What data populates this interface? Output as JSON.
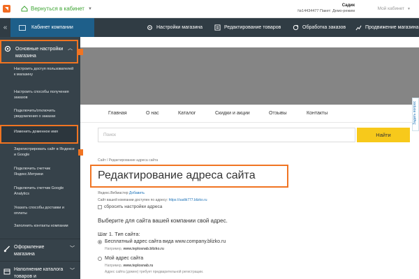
{
  "topbar": {
    "back_label": "Вернуться в кабинет",
    "user_name": "Садик",
    "user_meta": "№14434477 Пакет: Демо-режим",
    "cabinet_label": "Мой кабинет"
  },
  "navbar": {
    "company_label": "Кабинет компании",
    "items": [
      {
        "label": "Настройки магазина",
        "icon": "gear-icon"
      },
      {
        "label": "Редактирование товаров",
        "icon": "list-icon"
      },
      {
        "label": "Обработка заказов",
        "icon": "refresh-icon"
      },
      {
        "label": "Продвижение магазина",
        "icon": "chart-icon"
      }
    ]
  },
  "sidebar": {
    "main_label": "Основные настройки магазина",
    "subitems": [
      "Настроить доступ пользователей к магазину",
      "Настроить способы получения заказов",
      "Подключить/отключить уведомления о заказах",
      "Изменить доменное имя",
      "Зарегистрировать сайт в Яндексе и Google",
      "Подключить счетчик Яндекс.Метрики",
      "Подключить счетчик Google Analytics",
      "Указать способы доставки и оплаты",
      "Заполнить контакты компании"
    ],
    "categories": [
      {
        "label": "Оформление магазина",
        "icon": "brush-icon"
      },
      {
        "label": "Наполнение каталога товаров и",
        "icon": "box-icon"
      }
    ]
  },
  "site_menu": [
    "Главная",
    "О нас",
    "Каталог",
    "Скидки и акции",
    "Отзывы",
    "Контакты"
  ],
  "search": {
    "placeholder": "Поиск",
    "button": "Найти"
  },
  "feedback_label": "Задать вопрос",
  "page": {
    "breadcrumb": "Сайт / Редактирование адреса сайта",
    "title": "Редактирование адреса сайта",
    "webmaster_text": "Яндекс.Вебмастер",
    "webmaster_link": "Добавить",
    "url_text": "Сайт вашей компании доступен по адресу:",
    "url_link": "https://sadik777.blizko.ru",
    "reset_label": "сбросить настройки адреса",
    "choose_label": "Выберите для сайта вашей компании свой адрес.",
    "step_label": "Шаг 1. Тип сайта:",
    "options": [
      {
        "label": "Бесплатный адрес сайта вида www.company.blizko.ru",
        "hint_prefix": "Например,",
        "hint_value": "www.teplosnab.blizko.ru",
        "hint_suffix": "",
        "selected": true
      },
      {
        "label": "Мой адрес сайта",
        "hint_prefix": "Например,",
        "hint_value": "www.teplosnab.ru",
        "hint_suffix": "Адрес сайта (домен) требует предварительной регистрации.",
        "selected": false
      }
    ]
  },
  "colors": {
    "accent_orange": "#f07422",
    "nav_dark": "#303c44",
    "sidebar_dark": "#36424a",
    "company_tab_blue": "#1e5f8a",
    "button_yellow": "#f7c91b",
    "link_green": "#3fa535"
  }
}
